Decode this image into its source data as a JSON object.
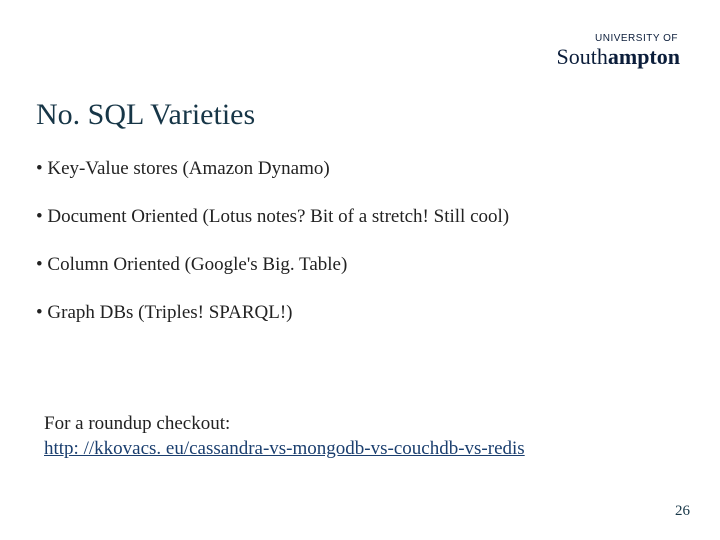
{
  "logo": {
    "line1": "UNIVERSITY OF",
    "line2_light": "South",
    "line2_bold": "ampton"
  },
  "title": "No. SQL Varieties",
  "bullets": [
    "Key-Value stores (Amazon Dynamo)",
    "Document Oriented (Lotus notes? Bit of a stretch! Still cool)",
    "Column Oriented (Google's Big. Table)",
    "Graph DBs (Triples! SPARQL!)"
  ],
  "footer": {
    "lead": "For a roundup checkout:",
    "link_text": "http: //kkovacs. eu/cassandra-vs-mongodb-vs-couchdb-vs-redis",
    "link_href": "http://kkovacs.eu/cassandra-vs-mongodb-vs-couchdb-vs-redis"
  },
  "page_number": "26"
}
